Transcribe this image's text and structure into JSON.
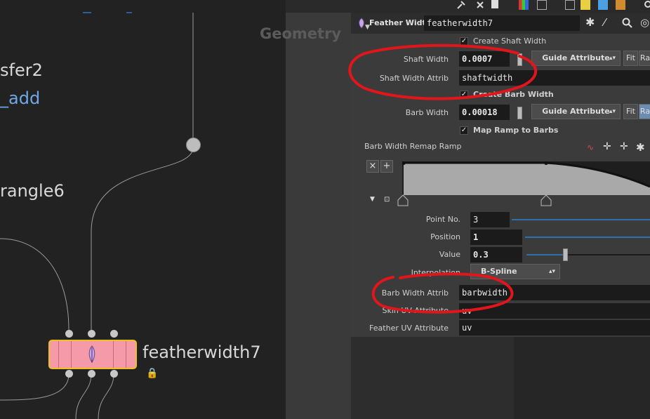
{
  "network": {
    "nodes": {
      "xfer": "sfer2",
      "add": "_add",
      "triangle": "rangle6",
      "feather": "featherwidth7"
    },
    "context_label": "Geometry"
  },
  "header": {
    "node_type": "Feather Width",
    "node_name": "featherwidth7"
  },
  "params": {
    "create_shaft_width": "Create Shaft Width",
    "shaft_width_label": "Shaft Width",
    "shaft_width_value": "0.0007",
    "shaft_mode": "Guide Attribute",
    "fit_label": "Fit",
    "ra_label": "Ra",
    "shaft_attrib_label": "Shaft Width Attrib",
    "shaft_attrib_value": "shaftwidth",
    "create_barb_width": "Create Barb Width",
    "barb_width_label": "Barb Width",
    "barb_width_value": "0.00018",
    "barb_mode": "Guide Attribute",
    "map_ramp": "Map Ramp to Barbs",
    "ramp_label": "Barb Width Remap Ramp",
    "point_no_label": "Point No.",
    "point_no_value": "3",
    "position_label": "Position",
    "position_value": "1",
    "value_label": "Value",
    "value_value": "0.3",
    "interp_label": "Interpolation",
    "interp_value": "B-Spline",
    "barb_attrib_label": "Barb Width Attrib",
    "barb_attrib_value": "barbwidth",
    "skin_uv_label": "Skin UV Attribute",
    "skin_uv_value": "uv",
    "feather_uv_label": "Feather UV Attribute",
    "feather_uv_value": "uv"
  },
  "icons": [
    "wrench-icon",
    "gear-icon",
    "brush-icon",
    "search-icon",
    "help-icon",
    "lock-icon"
  ],
  "colors": {
    "node_fill": "#f49aa8",
    "node_border": "#f0c020",
    "annotation": "#e0161c",
    "slider": "#2f6fb0"
  }
}
